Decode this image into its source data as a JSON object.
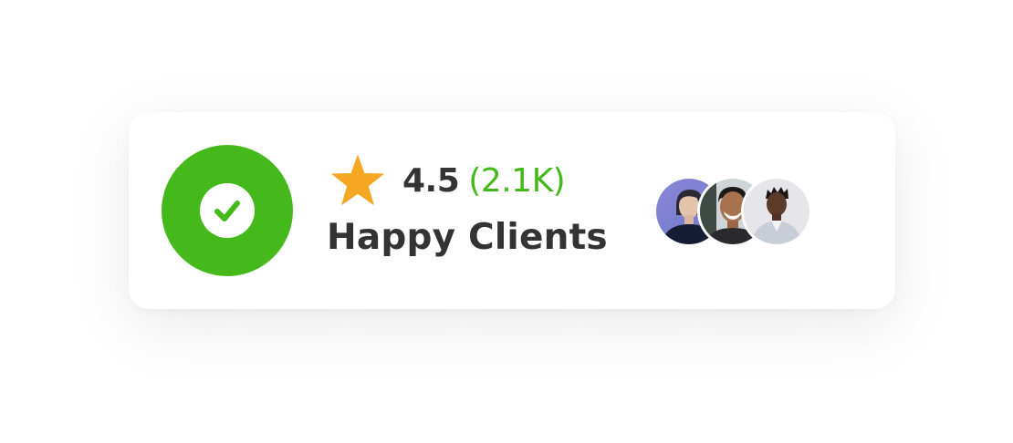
{
  "widget": {
    "badge_icon": "check-circle-icon",
    "rating": "4.5",
    "count": "(2.1K)",
    "title": "Happy Clients",
    "star_icon": "star-icon",
    "avatars": [
      {
        "name": "client-avatar-1",
        "icon": "person-icon"
      },
      {
        "name": "client-avatar-2",
        "icon": "person-icon"
      },
      {
        "name": "client-avatar-3",
        "icon": "person-icon"
      }
    ]
  },
  "colors": {
    "accent_green": "#45b91c",
    "star_orange": "#f5a623",
    "text_dark": "#333333",
    "card_bg": "#ffffff"
  }
}
